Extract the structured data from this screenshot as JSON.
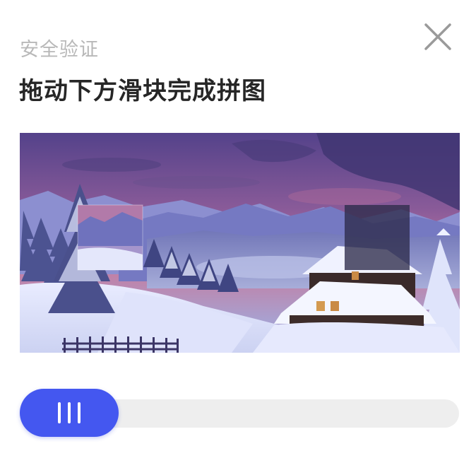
{
  "dialog": {
    "subtitle": "安全验证",
    "title": "拖动下方滑块完成拼图",
    "close_icon": "close-icon"
  },
  "puzzle": {
    "scene": "snowy-mountain-cabin",
    "piece_icon": "puzzle-piece",
    "target_icon": "puzzle-target-slot"
  },
  "slider": {
    "handle_icon": "grip-lines-icon",
    "progress": 0,
    "colors": {
      "handle": "#4457f0",
      "track": "#eeeeee"
    }
  },
  "colors": {
    "title": "#262626",
    "subtitle": "#b8b8b8",
    "close": "#9a9a9a"
  }
}
